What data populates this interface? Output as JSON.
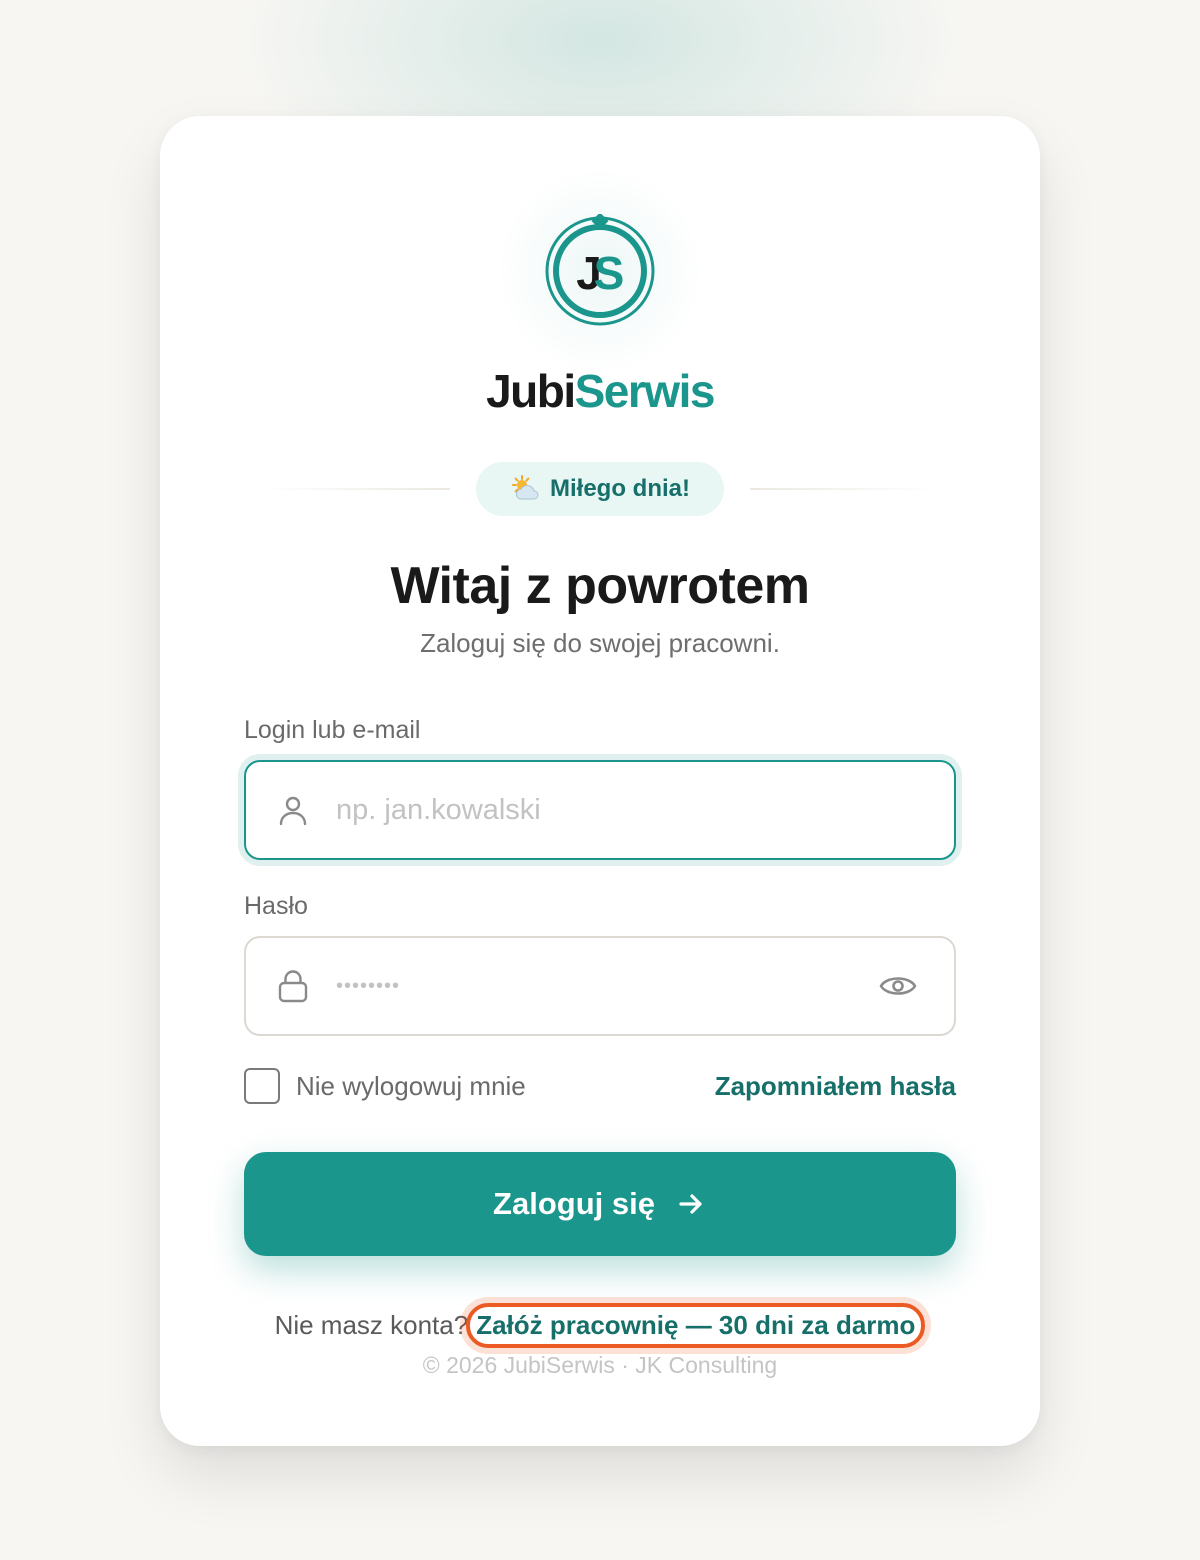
{
  "brand": {
    "name_part1": "Jubi",
    "name_part2": "Serwis",
    "monogram": "JS"
  },
  "greeting": {
    "text": "Miłego dnia!",
    "icon": "sun-behind-cloud-icon"
  },
  "header": {
    "title": "Witaj z powrotem",
    "subtitle": "Zaloguj się do swojej pracowni."
  },
  "form": {
    "login_label": "Login lub e-mail",
    "login_placeholder": "np. jan.kowalski",
    "login_value": "",
    "password_label": "Hasło",
    "password_masked": "••••••••",
    "remember_label": "Nie wylogowuj mnie",
    "remember_checked": false,
    "forgot_label": "Zapomniałem hasła",
    "submit_label": "Zaloguj się"
  },
  "signup": {
    "prompt": "Nie masz konta?",
    "link_label": "Załóż pracownię — 30 dni za darmo"
  },
  "footer": {
    "copyright": "© 2026 JubiSerwis · JK Consulting"
  },
  "colors": {
    "accent": "#1b968c",
    "accent_dark": "#176f69",
    "highlight": "#ec5a24",
    "background": "#f7f6f3"
  }
}
